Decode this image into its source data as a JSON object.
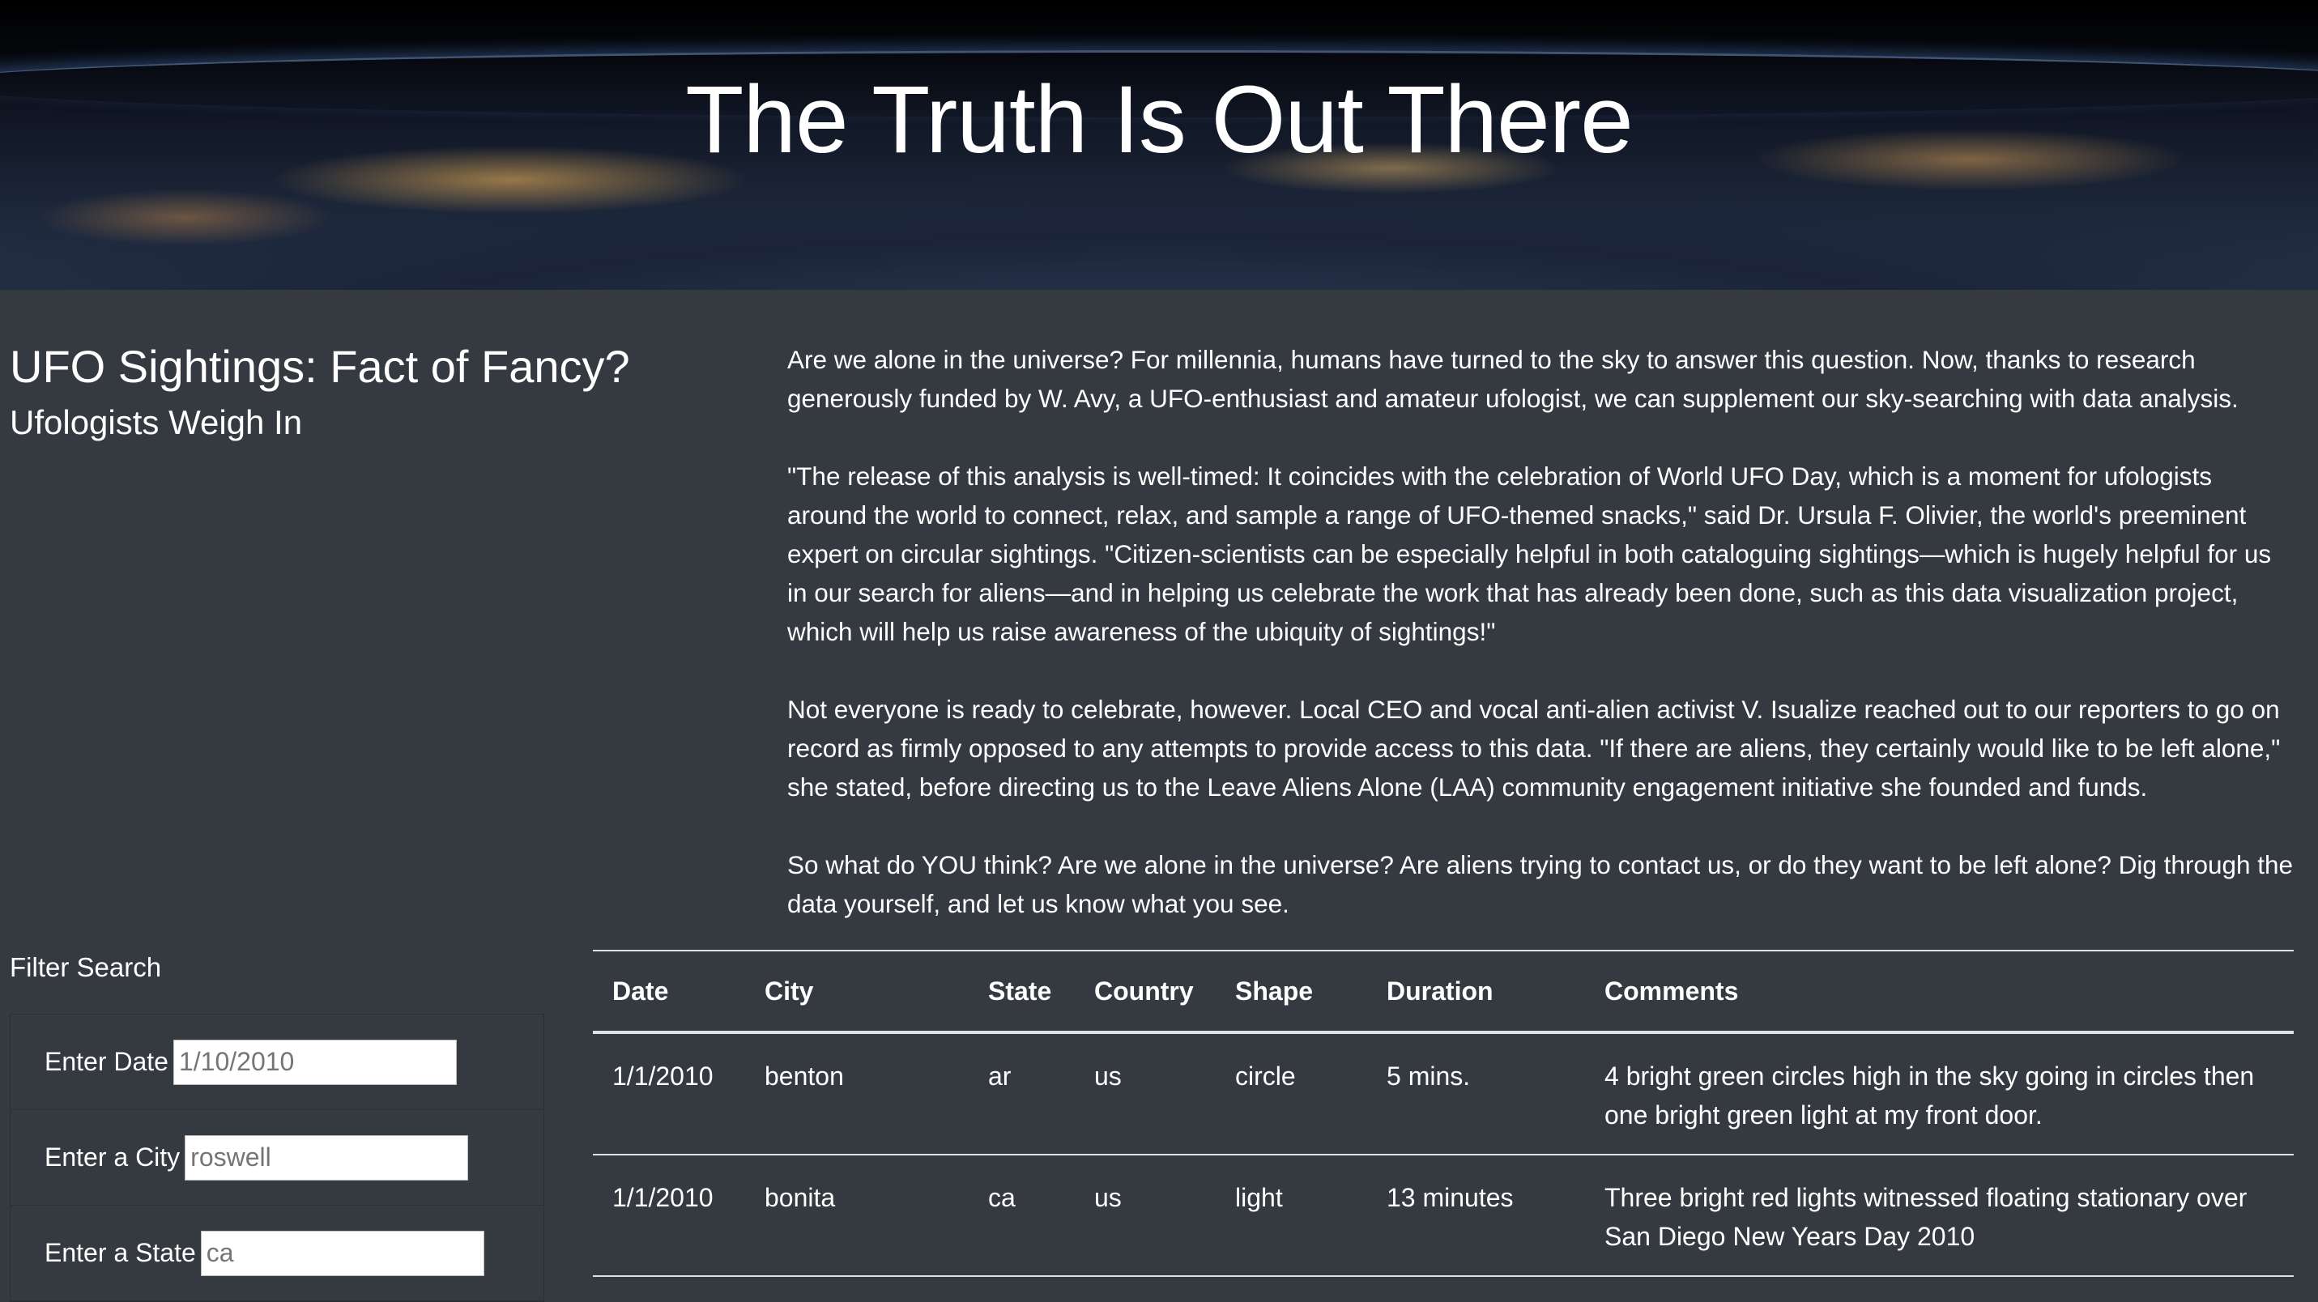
{
  "hero": {
    "title": "The Truth Is Out There"
  },
  "headline": "UFO Sightings: Fact of Fancy?",
  "subheadline": "Ufologists Weigh In",
  "article": {
    "paragraphs": [
      "Are we alone in the universe? For millennia, humans have turned to the sky to answer this question. Now, thanks to research generously funded by W. Avy, a UFO-enthusiast and amateur ufologist, we can supplement our sky-searching with data analysis.",
      "\"The release of this analysis is well-timed: It coincides with the celebration of World UFO Day, which is a moment for ufologists around the world to connect, relax, and sample a range of UFO-themed snacks,\" said Dr. Ursula F. Olivier, the world's preeminent expert on circular sightings. \"Citizen-scientists can be especially helpful in both cataloguing sightings—which is hugely helpful for us in our search for aliens—and in helping us celebrate the work that has already been done, such as this data visualization project, which will help us raise awareness of the ubiquity of sightings!\"",
      "Not everyone is ready to celebrate, however. Local CEO and vocal anti-alien activist V. Isualize reached out to our reporters to go on record as firmly opposed to any attempts to provide access to this data. \"If there are aliens, they certainly would like to be left alone,\" she stated, before directing us to the Leave Aliens Alone (LAA) community engagement initiative she founded and funds.",
      "So what do YOU think? Are we alone in the universe? Are aliens trying to contact us, or do they want to be left alone? Dig through the data yourself, and let us know what you see."
    ]
  },
  "filters": {
    "title": "Filter Search",
    "date": {
      "label": "Enter Date",
      "placeholder": "1/10/2010"
    },
    "city": {
      "label": "Enter a City",
      "placeholder": "roswell"
    },
    "state": {
      "label": "Enter a State",
      "placeholder": "ca"
    }
  },
  "table": {
    "headers": [
      "Date",
      "City",
      "State",
      "Country",
      "Shape",
      "Duration",
      "Comments"
    ],
    "rows": [
      [
        "1/1/2010",
        "benton",
        "ar",
        "us",
        "circle",
        "5 mins.",
        "4 bright green circles high in the sky going in circles then one bright green light at my front door."
      ],
      [
        "1/1/2010",
        "bonita",
        "ca",
        "us",
        "light",
        "13 minutes",
        "Three bright red lights witnessed floating stationary over San Diego New Years Day 2010"
      ]
    ]
  }
}
